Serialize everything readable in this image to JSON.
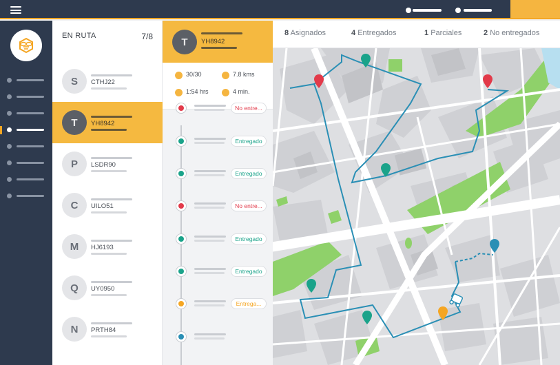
{
  "topbar": {
    "menu_icon": "hamburger-icon",
    "accent_color": "#f5a623"
  },
  "sidebar": {
    "logo_icon": "bee-logo-icon",
    "active_index": 3,
    "item_count": 8
  },
  "vehicle_list": {
    "title": "EN RUTA",
    "count": "7/8",
    "vehicles": [
      {
        "initial": "S",
        "code": "CTHJ22"
      },
      {
        "initial": "T",
        "code": "YH8942"
      },
      {
        "initial": "P",
        "code": "LSDR90"
      },
      {
        "initial": "C",
        "code": "UILO51"
      },
      {
        "initial": "M",
        "code": "HJ6193"
      },
      {
        "initial": "Q",
        "code": "UY0950"
      },
      {
        "initial": "N",
        "code": "PRTH84"
      }
    ],
    "selected_code": "YH8942"
  },
  "route": {
    "initial": "T",
    "code": "YH8942",
    "stats": {
      "deliveries": "30/30",
      "distance": "7.8 kms",
      "duration": "1:54 hrs",
      "stop_time": "4 min."
    },
    "stops": [
      {
        "status": "No entre...",
        "color": "#e23a4a"
      },
      {
        "status": "Entregado",
        "color": "#1aa38a"
      },
      {
        "status": "Entregado",
        "color": "#1aa38a"
      },
      {
        "status": "No entre...",
        "color": "#e23a4a"
      },
      {
        "status": "Entregado",
        "color": "#1aa38a"
      },
      {
        "status": "Entregado",
        "color": "#1aa38a"
      },
      {
        "status": "Entrega...",
        "color": "#f5a623"
      },
      {
        "status": "",
        "color": "#2a8fb5"
      }
    ]
  },
  "summary": {
    "assigned": {
      "count": "8",
      "label": "Asignados"
    },
    "delivered": {
      "count": "4",
      "label": "Entregados"
    },
    "partial": {
      "count": "1",
      "label": "Parciales"
    },
    "not_delivered": {
      "count": "2",
      "label": "No entregados"
    }
  },
  "colors": {
    "route": "#2a8fb5",
    "delivered": "#1aa38a",
    "failed": "#e23a4a",
    "partial": "#f5a623",
    "pending": "#2a8fb5",
    "park": "#8fd16a",
    "water": "#b7dff0"
  }
}
